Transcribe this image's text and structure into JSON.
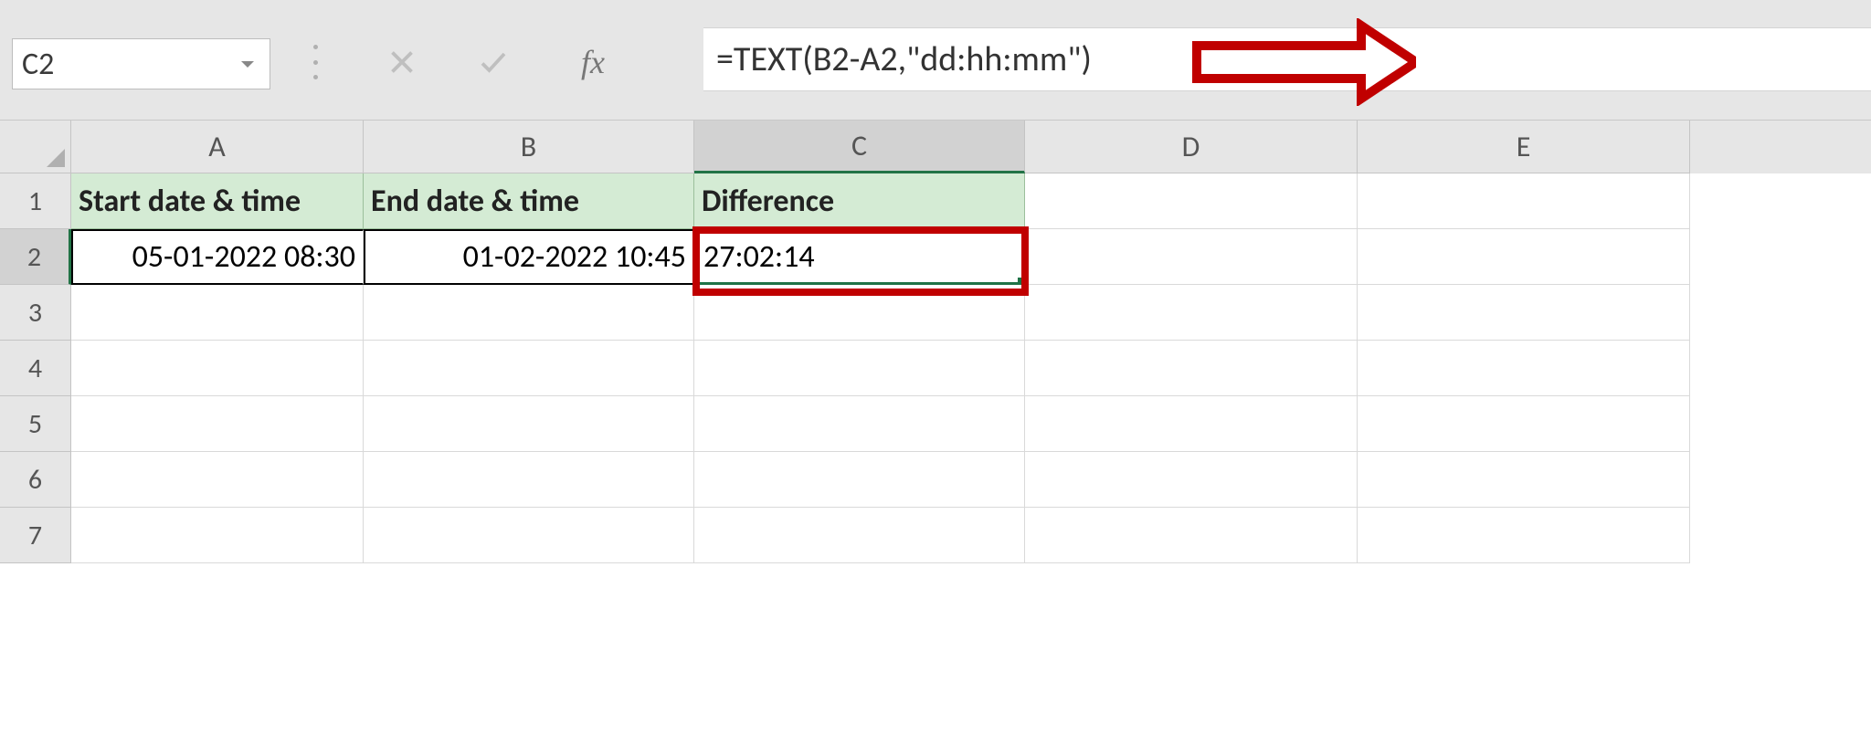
{
  "formula_bar": {
    "name_box": "C2",
    "formula": "=TEXT(B2-A2,\"dd:hh:mm\")",
    "fx_label": "fx"
  },
  "columns": [
    "A",
    "B",
    "C",
    "D",
    "E"
  ],
  "rows": [
    "1",
    "2",
    "3",
    "4",
    "5",
    "6",
    "7"
  ],
  "headers": {
    "A1": "Start date & time",
    "B1": "End date & time",
    "C1": "Difference"
  },
  "data": {
    "A2": "05-01-2022 08:30",
    "B2": "01-02-2022 10:45",
    "C2": "27:02:14"
  },
  "selected_cell": "C2"
}
